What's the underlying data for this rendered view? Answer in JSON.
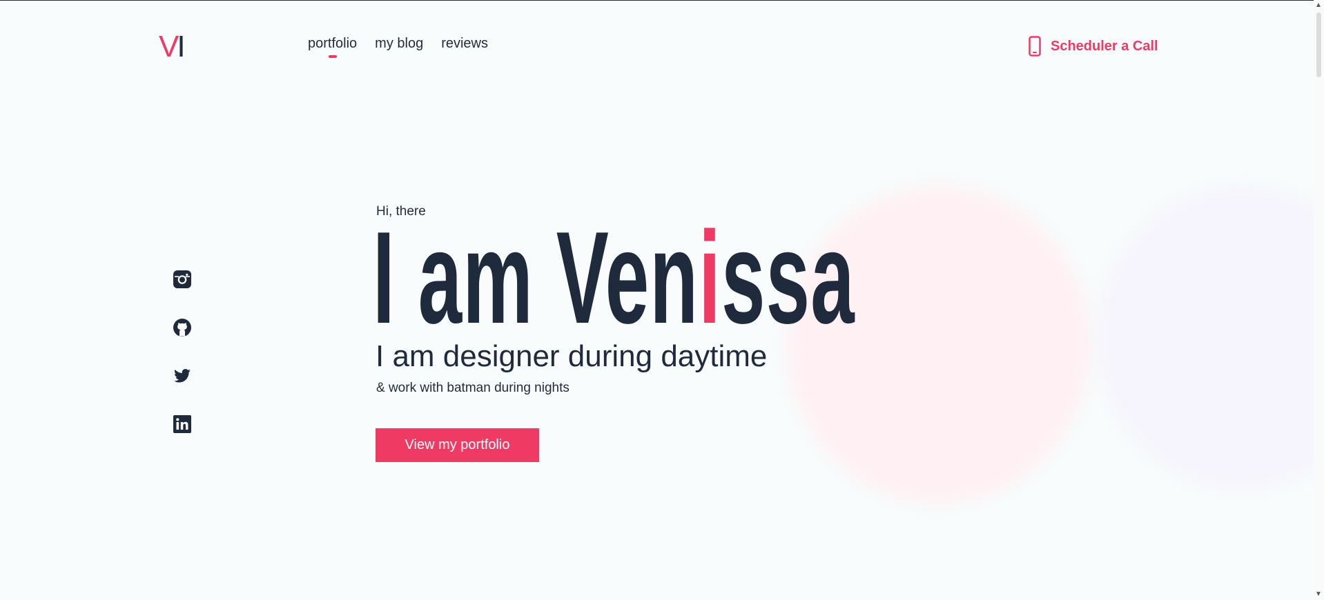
{
  "header": {
    "logo": {
      "part1": "V",
      "part2": "I"
    },
    "nav": [
      {
        "label": "portfolio",
        "active": true
      },
      {
        "label": "my blog",
        "active": false
      },
      {
        "label": "reviews",
        "active": false
      }
    ],
    "cta_label": "Scheduler a Call"
  },
  "social": [
    {
      "icon": "instagram-icon"
    },
    {
      "icon": "github-icon"
    },
    {
      "icon": "twitter-icon"
    },
    {
      "icon": "linkedin-icon"
    }
  ],
  "hero": {
    "greeting": "Hi, there",
    "title_before": "I am Ven",
    "title_accent": "i",
    "title_after": "ssa",
    "subtitle": "I am designer during daytime",
    "subline": "& work with batman during nights",
    "button_label": "View my portfolio"
  },
  "colors": {
    "accent": "#ef3a63",
    "text": "#1f2a3c",
    "background": "#f8fcfc"
  }
}
